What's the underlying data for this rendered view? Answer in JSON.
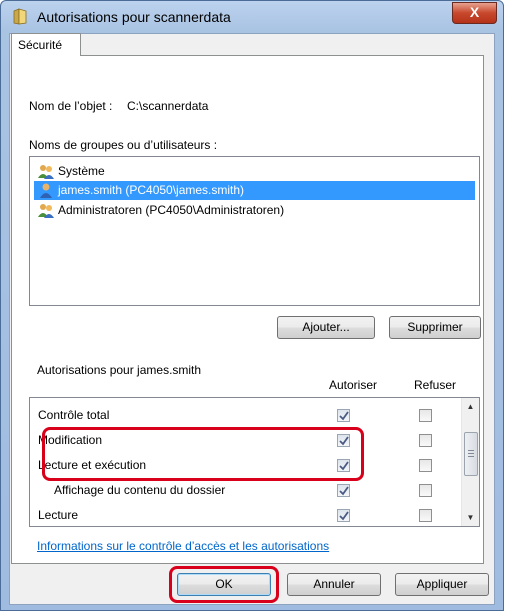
{
  "window": {
    "title": "Autorisations pour scannerdata",
    "close_label": "X"
  },
  "tabs": [
    {
      "label": "Sécurité"
    }
  ],
  "object": {
    "label": "Nom de l’objet :",
    "value": "C:\\scannerdata"
  },
  "groups": {
    "label": "Noms de groupes ou d’utilisateurs :",
    "items": [
      {
        "label": "Système",
        "icon": "group-icon"
      },
      {
        "label": "james.smith (PC4050\\james.smith)",
        "icon": "user-icon",
        "selected": true
      },
      {
        "label": "Administratoren (PC4050\\Administratoren)",
        "icon": "group-icon"
      }
    ],
    "add_label": "Ajouter...",
    "remove_label": "Supprimer"
  },
  "permissions": {
    "label": "Autorisations pour james.smith",
    "allow_header": "Autoriser",
    "deny_header": "Refuser",
    "rows": [
      {
        "name": "Contrôle total",
        "allow": true,
        "deny": false
      },
      {
        "name": "Modification",
        "allow": true,
        "deny": false
      },
      {
        "name": "Lecture et exécution",
        "allow": true,
        "deny": false
      },
      {
        "name": "Affichage du contenu du dossier",
        "allow": true,
        "deny": false
      },
      {
        "name": "Lecture",
        "allow": true,
        "deny": false
      }
    ]
  },
  "link_text": "Informations sur le contrôle d’accès et les autorisations",
  "footer": {
    "ok_label": "OK",
    "cancel_label": "Annuler",
    "apply_label": "Appliquer"
  },
  "colors": {
    "highlight": "#d9001b",
    "selection": "#3399ff",
    "link": "#0066cc"
  }
}
